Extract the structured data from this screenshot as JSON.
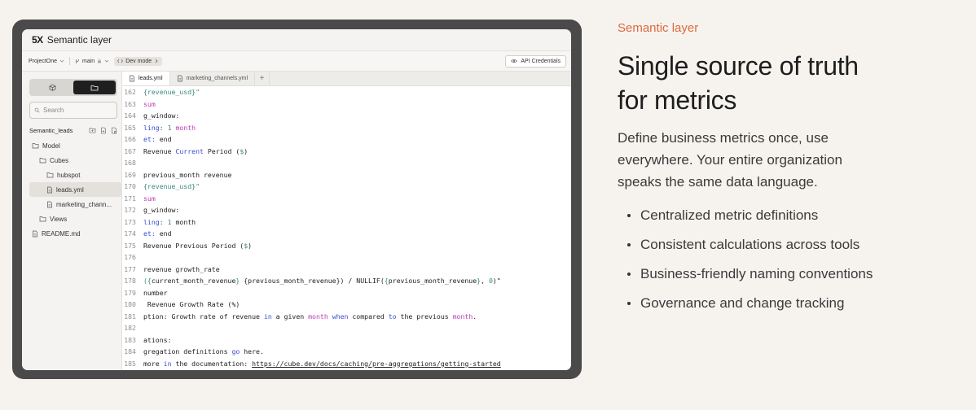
{
  "app": {
    "logo": "5X",
    "title": "Semantic layer"
  },
  "toolbar": {
    "project": "ProjectOne",
    "branch": "main",
    "mode": "Dev mode",
    "api_button": "API Credentials"
  },
  "sidebar": {
    "search_placeholder": "Search",
    "project_label": "Semantic_leads",
    "tree": [
      {
        "label": "Model",
        "type": "folder",
        "depth": 0
      },
      {
        "label": "Cubes",
        "type": "folder",
        "depth": 1
      },
      {
        "label": "hubspot",
        "type": "folder",
        "depth": 2
      },
      {
        "label": "leads.yml",
        "type": "file",
        "depth": 2,
        "selected": true
      },
      {
        "label": "marketing_chann...",
        "type": "file",
        "depth": 2
      },
      {
        "label": "Views",
        "type": "folder",
        "depth": 1
      },
      {
        "label": "README.md",
        "type": "file",
        "depth": 0
      }
    ]
  },
  "editor": {
    "tabs": [
      {
        "label": "leads.yml",
        "active": true
      },
      {
        "label": "marketing_channels.yml",
        "active": false
      }
    ],
    "lines": [
      {
        "n": "162",
        "parts": [
          [
            "t",
            "{revenue_usd}\""
          ]
        ]
      },
      {
        "n": "163",
        "parts": [
          [
            "m",
            "sum"
          ]
        ]
      },
      {
        "n": "164",
        "parts": [
          [
            "",
            "g_window:"
          ]
        ]
      },
      {
        "n": "165",
        "parts": [
          [
            "k",
            "ling:"
          ],
          [
            "",
            " "
          ],
          [
            "t",
            "1"
          ],
          [
            "",
            " "
          ],
          [
            "m",
            "month"
          ]
        ]
      },
      {
        "n": "166",
        "parts": [
          [
            "k",
            "et:"
          ],
          [
            "",
            " end"
          ]
        ]
      },
      {
        "n": "167",
        "parts": [
          [
            "",
            "Revenue "
          ],
          [
            "k",
            "Current"
          ],
          [
            "",
            " Period ("
          ],
          [
            "t",
            "$"
          ],
          [
            "",
            ")"
          ]
        ]
      },
      {
        "n": "168",
        "parts": [
          [
            "",
            ""
          ]
        ]
      },
      {
        "n": "169",
        "parts": [
          [
            "",
            "previous_month revenue"
          ]
        ]
      },
      {
        "n": "170",
        "parts": [
          [
            "t",
            "{revenue_usd}\""
          ]
        ]
      },
      {
        "n": "171",
        "parts": [
          [
            "m",
            "sum"
          ]
        ]
      },
      {
        "n": "172",
        "parts": [
          [
            "",
            "g_window:"
          ]
        ]
      },
      {
        "n": "173",
        "parts": [
          [
            "k",
            "ling:"
          ],
          [
            "",
            " "
          ],
          [
            "t",
            "1"
          ],
          [
            "",
            " month"
          ]
        ]
      },
      {
        "n": "174",
        "parts": [
          [
            "k",
            "et:"
          ],
          [
            "",
            " end"
          ]
        ]
      },
      {
        "n": "175",
        "parts": [
          [
            "",
            "Revenue Previous Period ("
          ],
          [
            "t",
            "$"
          ],
          [
            "",
            ")"
          ]
        ]
      },
      {
        "n": "176",
        "parts": [
          [
            "",
            ""
          ]
        ]
      },
      {
        "n": "177",
        "parts": [
          [
            "",
            "revenue growth_rate"
          ]
        ]
      },
      {
        "n": "178",
        "parts": [
          [
            "t",
            "({"
          ],
          [
            "",
            "current_month_revenue"
          ],
          [
            "t",
            "}"
          ],
          [
            "",
            " {previous_month_revenue}) / NULLIF("
          ],
          [
            "t",
            "{"
          ],
          [
            "",
            "previous_month_revenue"
          ],
          [
            "t",
            "}"
          ],
          [
            "",
            ", "
          ],
          [
            "t",
            "0"
          ],
          [
            "",
            ")\""
          ]
        ]
      },
      {
        "n": "179",
        "parts": [
          [
            "",
            "number"
          ]
        ]
      },
      {
        "n": "180",
        "parts": [
          [
            "",
            " Revenue Growth Rate (%)"
          ]
        ]
      },
      {
        "n": "181",
        "parts": [
          [
            "",
            "ption: Growth rate of revenue "
          ],
          [
            "k",
            "in"
          ],
          [
            "",
            " a given "
          ],
          [
            "m",
            "month"
          ],
          [
            "",
            " "
          ],
          [
            "k",
            "when"
          ],
          [
            "",
            " compared "
          ],
          [
            "k",
            "to"
          ],
          [
            "",
            " the previous "
          ],
          [
            "m",
            "month"
          ],
          [
            "",
            "."
          ]
        ]
      },
      {
        "n": "182",
        "parts": [
          [
            "",
            ""
          ]
        ]
      },
      {
        "n": "183",
        "parts": [
          [
            "",
            "ations:"
          ]
        ]
      },
      {
        "n": "184",
        "parts": [
          [
            "",
            "gregation definitions "
          ],
          [
            "k",
            "go"
          ],
          [
            "",
            " here."
          ]
        ]
      },
      {
        "n": "185",
        "parts": [
          [
            "",
            "more "
          ],
          [
            "k",
            "in"
          ],
          [
            "",
            " the documentation: "
          ],
          [
            "u",
            "https://cube.dev/docs/caching/pre-aggregations/getting-started"
          ]
        ]
      }
    ]
  },
  "copy": {
    "eyebrow": "Semantic layer",
    "headline_line1": "Single source of truth",
    "headline_line2": "for metrics",
    "description": "Define business metrics once, use everywhere. Your entire organization speaks the same data language.",
    "bullets": [
      "Centralized metric definitions",
      "Consistent calculations across tools",
      "Business-friendly naming conventions",
      "Governance and change tracking"
    ]
  },
  "colors": {
    "accent": "#dd6a3e",
    "frame": "#4a4a4a",
    "background": "#f6f3ef"
  }
}
